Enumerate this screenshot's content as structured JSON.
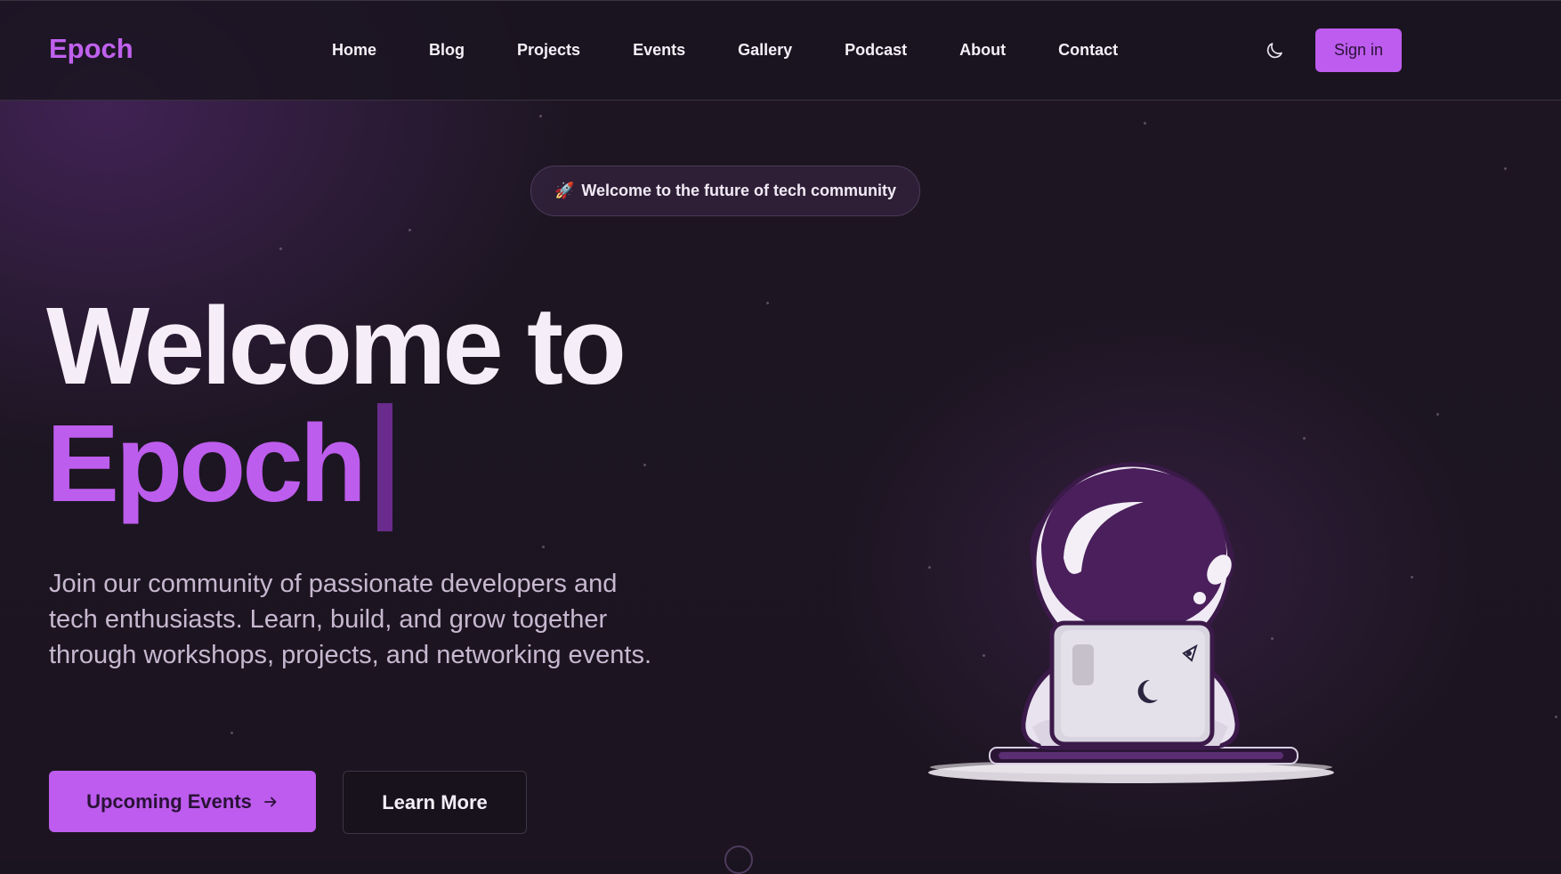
{
  "brand": {
    "name": "Epoch",
    "accent": "#bd5cee"
  },
  "nav": {
    "links": [
      "Home",
      "Blog",
      "Projects",
      "Events",
      "Gallery",
      "Podcast",
      "About",
      "Contact"
    ],
    "theme_toggle_icon": "moon-icon",
    "signin_label": "Sign in"
  },
  "hero": {
    "badge_emoji": "🚀",
    "badge_text": "Welcome to the future of tech community",
    "title_line1": "Welcome to",
    "title_line2": "Epoch",
    "description": "Join our community of passionate developers and tech enthusiasts. Learn, build, and grow together through workshops, projects, and networking events.",
    "primary_button": "Upcoming Events",
    "primary_button_icon": "arrow-right-icon",
    "secondary_button": "Learn More",
    "illustration": "astronaut-with-laptop-illustration"
  }
}
